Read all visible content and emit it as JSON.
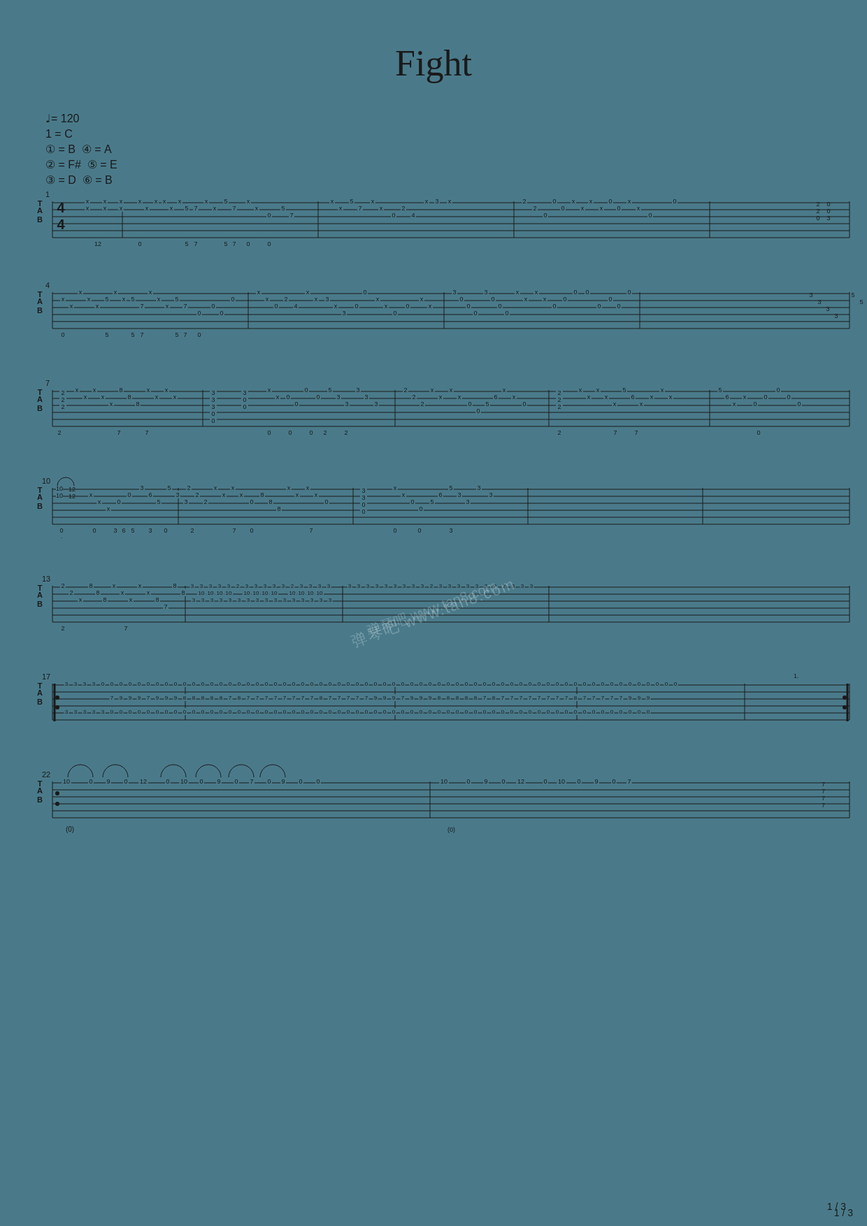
{
  "title": "Fight",
  "metadata": {
    "tempo": "♩= 120",
    "key": "1 = C",
    "tuning": [
      "① = B  ④ = A",
      "② = F#  ⑤ = E",
      "③ = D  ⑥ = B"
    ]
  },
  "page_number": "1 / 3",
  "watermark": "弹琴吧 www.tan8.com",
  "background_color": "#4a7a8a",
  "staff_color": "#1a1a1a"
}
